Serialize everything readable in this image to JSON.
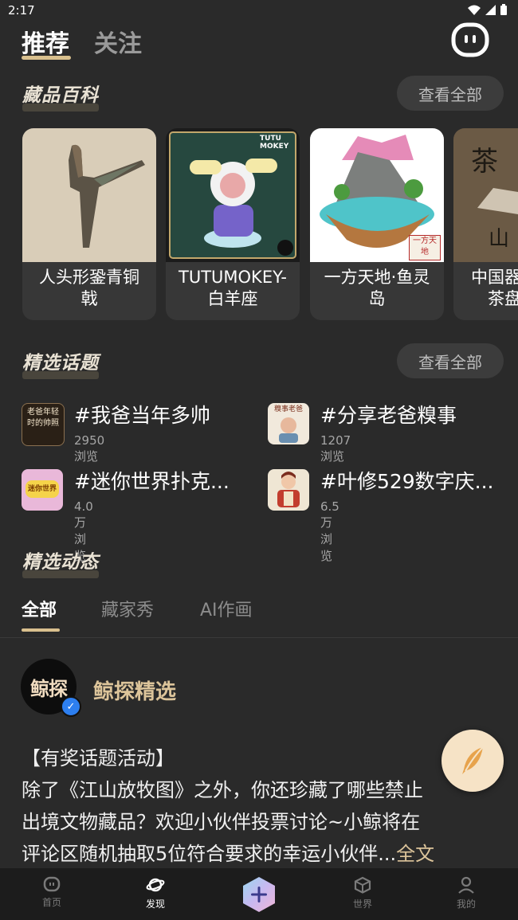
{
  "status_bar": {
    "time": "2:17"
  },
  "top_tabs": [
    {
      "label": "推荐"
    },
    {
      "label": "关注"
    }
  ],
  "sections": {
    "encyclopedia": {
      "title": "藏品百科",
      "see_all": "查看全部"
    },
    "topics": {
      "title": "精选话题",
      "see_all": "查看全部"
    },
    "feed": {
      "title": "精选动态"
    }
  },
  "cards": [
    {
      "name_line1": "人头形銎青铜",
      "name_line2": "戟"
    },
    {
      "name_line1": "TUTUMOKEY-",
      "name_line2": "白羊座"
    },
    {
      "name_line1": "一方天地·鱼灵",
      "name_line2": "岛"
    },
    {
      "name_line1": "中国器",
      "name_line2": "茶盘"
    }
  ],
  "card_art_text": {
    "tutu_badge": "TUTU MOKEY",
    "island_stamp": "一方天地",
    "tea_char1": "茶",
    "tea_char2": "山"
  },
  "topics": [
    {
      "title": "#我爸当年多帅",
      "views": "2950浏览",
      "thumb_text": "老爸年轻时的帅照"
    },
    {
      "title": "#分享老爸糗事",
      "views": "1207浏览",
      "thumb_text": "糗事老爸"
    },
    {
      "title": "#迷你世界扑克...",
      "views": "4.0万浏览",
      "thumb_text": "迷你世界"
    },
    {
      "title": "#叶修529数字庆...",
      "views": "6.5万浏览",
      "thumb_text": ""
    }
  ],
  "feed_tabs": [
    {
      "label": "全部"
    },
    {
      "label": "藏家秀"
    },
    {
      "label": "AI作画"
    }
  ],
  "post": {
    "avatar_text": "鲸探",
    "author": "鲸探精选",
    "line1": "【有奖话题活动】",
    "line2": "除了《江山放牧图》之外，你还珍藏了哪些禁止",
    "line3": "出境文物藏品？欢迎小伙伴投票讨论~小鲸将在",
    "line4": "评论区随机抽取5位符合要求的幸运小伙伴...",
    "more": "全文"
  },
  "bottom_nav": [
    {
      "label": "首页",
      "icon": "home-icon"
    },
    {
      "label": "发现",
      "icon": "discover-planet-icon"
    },
    {
      "label": "世界",
      "icon": "cube-world-icon"
    },
    {
      "label": "我的",
      "icon": "profile-icon"
    }
  ],
  "colors": {
    "accent": "#d9c08e",
    "background": "#2a2a2a",
    "card": "#373737"
  }
}
